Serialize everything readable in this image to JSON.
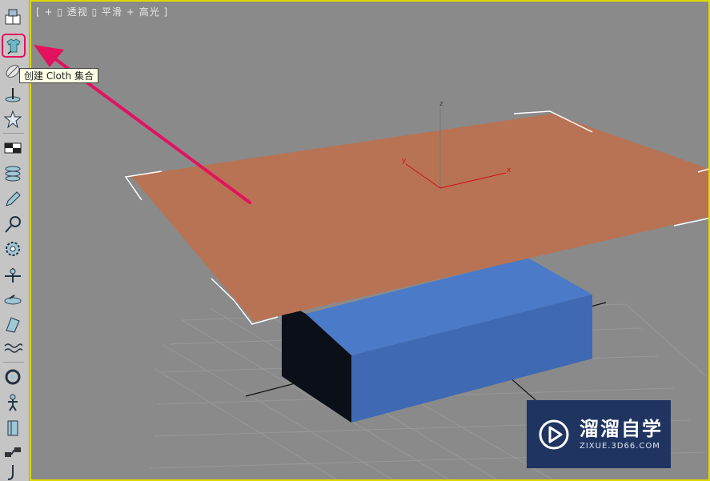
{
  "viewport": {
    "label": "[ + ▯ 透视 ▯ 平滑 + 高光 ]",
    "border_color": "#e0d900",
    "background_color": "#8a8a8a"
  },
  "toolbar": {
    "tools": [
      {
        "name": "bricks-icon"
      },
      {
        "name": "cloth-shirt-icon",
        "highlighted": true
      },
      {
        "name": "brush-icon"
      },
      {
        "name": "pin-icon"
      },
      {
        "name": "star-icon"
      },
      {
        "name": "checker-icon"
      },
      {
        "name": "stack-icon"
      },
      {
        "name": "pencil-icon"
      },
      {
        "name": "magnet-icon"
      },
      {
        "name": "gear-icon"
      },
      {
        "name": "joint-icon"
      },
      {
        "name": "disc-icon"
      },
      {
        "name": "bend-icon"
      },
      {
        "name": "wave-icon"
      },
      {
        "name": "ring-icon"
      },
      {
        "name": "figure-icon"
      },
      {
        "name": "panel-icon"
      },
      {
        "name": "link-icon"
      },
      {
        "name": "hook-icon"
      }
    ]
  },
  "tooltip": {
    "text": "创建 Cloth 集合"
  },
  "scene": {
    "axes": {
      "x": "x",
      "y": "y",
      "z": "z"
    },
    "plane_color": "#b87354",
    "box_color": "#4370b8",
    "arrow_color": "#e2125f"
  },
  "watermark": {
    "title": "溜溜自学",
    "subtitle": "ZIXUE.3D66.COM"
  }
}
